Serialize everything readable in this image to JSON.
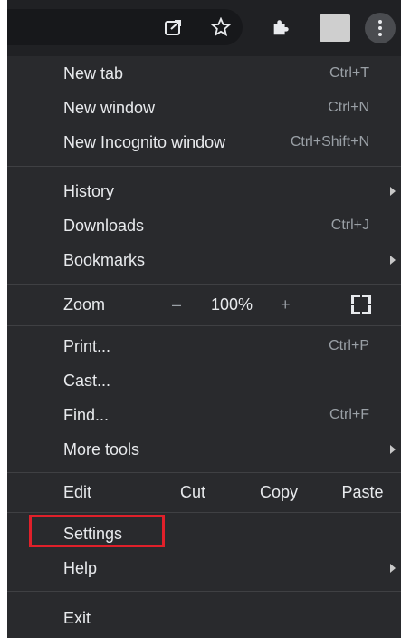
{
  "menu": {
    "new_tab": {
      "label": "New tab",
      "shortcut": "Ctrl+T"
    },
    "new_window": {
      "label": "New window",
      "shortcut": "Ctrl+N"
    },
    "new_incognito": {
      "label": "New Incognito window",
      "shortcut": "Ctrl+Shift+N"
    },
    "history": {
      "label": "History"
    },
    "downloads": {
      "label": "Downloads",
      "shortcut": "Ctrl+J"
    },
    "bookmarks": {
      "label": "Bookmarks"
    },
    "zoom": {
      "label": "Zoom",
      "minus": "–",
      "value": "100%",
      "plus": "+"
    },
    "print": {
      "label": "Print...",
      "shortcut": "Ctrl+P"
    },
    "cast": {
      "label": "Cast..."
    },
    "find": {
      "label": "Find...",
      "shortcut": "Ctrl+F"
    },
    "more_tools": {
      "label": "More tools"
    },
    "edit": {
      "label": "Edit",
      "cut": "Cut",
      "copy": "Copy",
      "paste": "Paste"
    },
    "settings": {
      "label": "Settings"
    },
    "help": {
      "label": "Help"
    },
    "exit": {
      "label": "Exit"
    }
  },
  "toolbar": {
    "icons": [
      "share-icon",
      "star-icon",
      "extensions-icon",
      "profile-avatar",
      "more-menu-icon"
    ]
  },
  "colors": {
    "menu_bg": "#292a2d",
    "text": "#e8eaed",
    "shortcut": "#9aa0a6",
    "highlight": "#e0202a"
  }
}
